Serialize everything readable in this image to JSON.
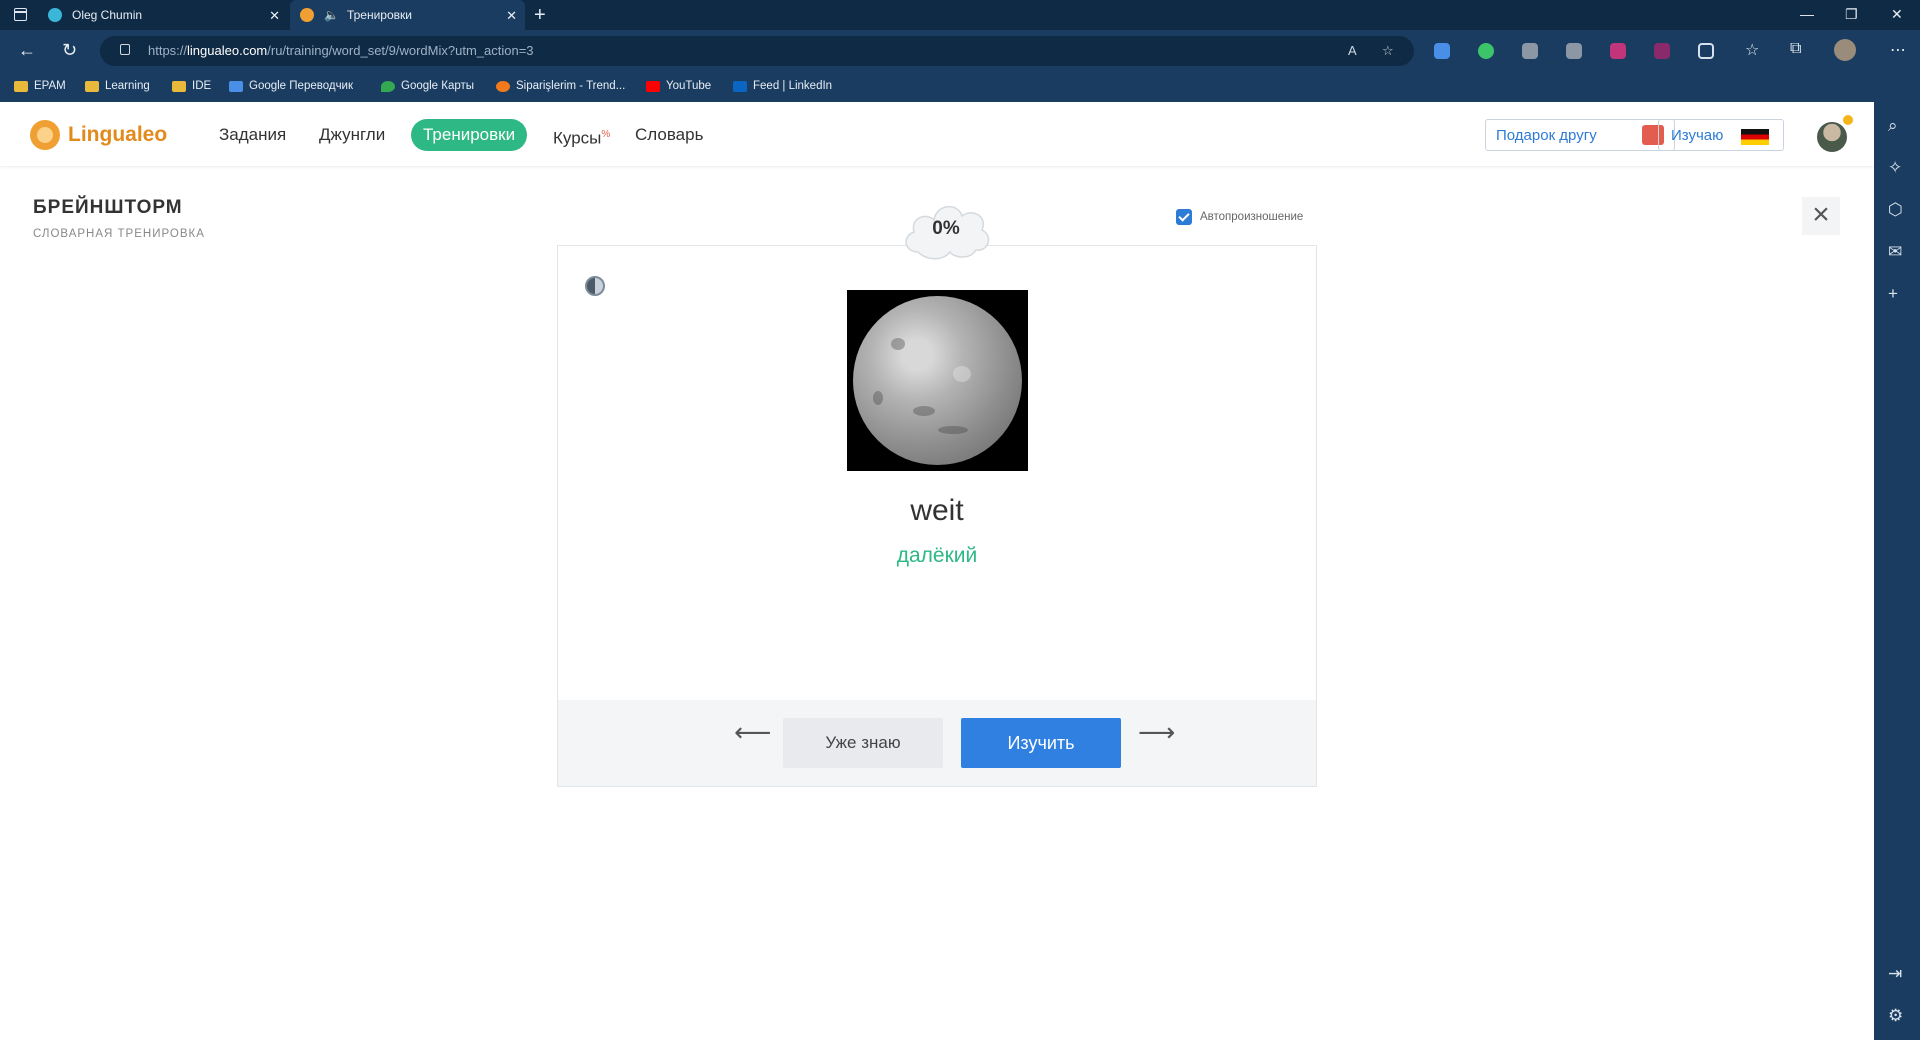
{
  "browser": {
    "tabs": [
      {
        "title": "Oleg Chumin",
        "favicon": "edge-icon"
      },
      {
        "title": "Тренировки",
        "favicon": "lingualeo-lion-icon",
        "audio": true
      }
    ],
    "url_prefix": "https://",
    "url_host": "lingualeo.com",
    "url_path": "/ru/training/word_set/9/wordMix?utm_action=3",
    "bookmarks": [
      {
        "label": "EPAM",
        "icon": "folder-icon"
      },
      {
        "label": "Learning",
        "icon": "folder-icon"
      },
      {
        "label": "IDE",
        "icon": "folder-icon"
      },
      {
        "label": "Google Переводчик",
        "icon": "google-translate-icon"
      },
      {
        "label": "Google Карты",
        "icon": "google-maps-icon"
      },
      {
        "label": "Siparişlerim - Trend...",
        "icon": "trendyol-icon"
      },
      {
        "label": "YouTube",
        "icon": "youtube-icon"
      },
      {
        "label": "Feed | LinkedIn",
        "icon": "linkedin-icon"
      }
    ]
  },
  "site": {
    "logo": "Lingualeo",
    "nav": [
      "Задания",
      "Джунгли",
      "Тренировки",
      "Курсы",
      "Словарь"
    ],
    "nav_active": "Тренировки",
    "courses_badge": "%",
    "gift_button": "Подарок другу",
    "learning_button": "Изучаю"
  },
  "training": {
    "title": "БРЕЙНШТОРМ",
    "subtitle": "СЛОВАРНАЯ ТРЕНИРОВКА",
    "autopronounce_label": "Автопроизношение",
    "autopronounce_checked": true,
    "progress": "0%",
    "word": "weit",
    "translation": "далёкий",
    "image": "moon-image",
    "know_button": "Уже знаю",
    "learn_button": "Изучить",
    "prev_arrow": "⟵",
    "next_arrow": "⟶"
  },
  "colors": {
    "accent_green": "#2eb886",
    "primary_blue": "#2f80e0",
    "logo_orange": "#e38a1d",
    "browser_dark": "#0f2a45"
  }
}
